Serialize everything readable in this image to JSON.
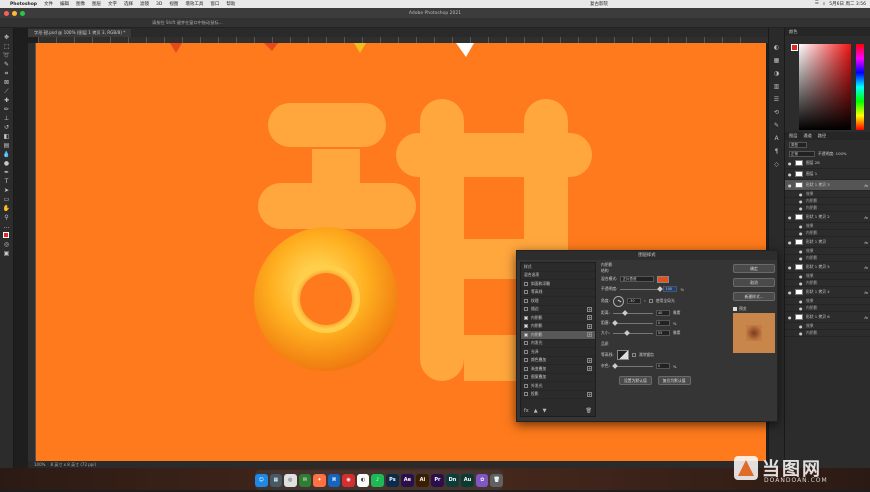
{
  "menubar": {
    "app": "Photoshop",
    "items": [
      "文件",
      "编辑",
      "图像",
      "图层",
      "文字",
      "选择",
      "滤镜",
      "3D",
      "视图",
      "增效工具",
      "窗口",
      "帮助"
    ],
    "center_text": "复古影院",
    "right_items": [
      "☰",
      "⌕",
      "5月6日 周二 3:56"
    ]
  },
  "titlebar": {
    "title": "Adobe Photoshop 2021"
  },
  "options_bar": {
    "hint": "请按住 Shift 键并在窗口中拖动鼠标…"
  },
  "document_tab": {
    "label": "字形·甜.psd @ 100% (图层 1 拷贝 3, RGB/8) *"
  },
  "status_bar": {
    "zoom": "100%",
    "info": "8 英寸 x 8 英寸 (72 ppi)"
  },
  "canvas": {
    "background": "#fe7a1c",
    "glyph_color": "#ffa63d",
    "donut_colors": [
      "#fdd835",
      "#ff9800",
      "#e65100"
    ]
  },
  "layers_panel": {
    "tabs": [
      "图层",
      "通道",
      "路径"
    ],
    "search_label": "类型",
    "blend_mode": "正常",
    "opacity_label": "不透明度: 100%",
    "layers": [
      {
        "name": "图层 28",
        "selected": false
      },
      {
        "name": "图层 1",
        "selected": false
      },
      {
        "name": "形状 1 拷贝 3",
        "selected": true,
        "fx": true
      },
      {
        "name": "效果",
        "sub": true
      },
      {
        "name": "内阴影",
        "sub": true
      },
      {
        "name": "内阴影",
        "sub": true
      },
      {
        "name": "形状 1 拷贝 2",
        "selected": false,
        "fx": true
      },
      {
        "name": "效果",
        "sub": true
      },
      {
        "name": "内阴影",
        "sub": true
      },
      {
        "name": "形状 1 拷贝",
        "selected": false,
        "fx": true
      },
      {
        "name": "效果",
        "sub": true
      },
      {
        "name": "内阴影",
        "sub": true
      },
      {
        "name": "形状 1 拷贝 5",
        "selected": false,
        "fx": true
      },
      {
        "name": "效果",
        "sub": true
      },
      {
        "name": "内阴影",
        "sub": true
      },
      {
        "name": "形状 1 拷贝 4",
        "selected": false,
        "fx": true
      },
      {
        "name": "效果",
        "sub": true
      },
      {
        "name": "内阴影",
        "sub": true
      },
      {
        "name": "形状 1 拷贝 6",
        "selected": false,
        "fx": true
      },
      {
        "name": "效果",
        "sub": true
      },
      {
        "name": "内阴影",
        "sub": true
      }
    ]
  },
  "dialog": {
    "title": "图层样式",
    "styles_header": "样式",
    "blend_options": "混合选项",
    "styles": [
      {
        "label": "斜面和浮雕",
        "checked": false,
        "plus": false
      },
      {
        "label": "等高线",
        "checked": false,
        "plus": false
      },
      {
        "label": "纹理",
        "checked": false,
        "plus": false
      },
      {
        "label": "描边",
        "checked": false,
        "plus": true
      },
      {
        "label": "内阴影",
        "checked": true,
        "plus": true
      },
      {
        "label": "内阴影",
        "checked": true,
        "plus": true
      },
      {
        "label": "内阴影",
        "checked": true,
        "plus": true,
        "selected": true
      },
      {
        "label": "内发光",
        "checked": false,
        "plus": false
      },
      {
        "label": "光泽",
        "checked": false,
        "plus": false
      },
      {
        "label": "颜色叠加",
        "checked": false,
        "plus": true
      },
      {
        "label": "渐变叠加",
        "checked": false,
        "plus": true
      },
      {
        "label": "图案叠加",
        "checked": false,
        "plus": false
      },
      {
        "label": "外发光",
        "checked": false,
        "plus": false
      },
      {
        "label": "投影",
        "checked": false,
        "plus": true
      }
    ],
    "section_title": "内阴影",
    "section_sub": "结构",
    "blend_mode_label": "混合模式:",
    "blend_mode_value": "正片叠底",
    "shadow_color": "#e3501b",
    "opacity_label": "不透明度:",
    "opacity_value": "100",
    "angle_label": "角度:",
    "angle_value": "-30",
    "global_light": "使用全局光",
    "distance_label": "距离:",
    "distance_value": "40",
    "choke_label": "阻塞:",
    "choke_value": "0",
    "size_label": "大小:",
    "size_value": "55",
    "unit_px": "像素",
    "unit_pct": "%",
    "quality_title": "品质",
    "contour_label": "等高线:",
    "antialias": "消除锯齿",
    "noise_label": "杂色:",
    "noise_value": "0",
    "default_btn": "设置为默认值",
    "reset_btn": "复位为默认值",
    "ok": "确定",
    "cancel": "取消",
    "new_style": "新建样式...",
    "preview_label": "预览"
  },
  "dock": {
    "apps": [
      {
        "name": "Ps",
        "color": "#0c2a4a"
      },
      {
        "name": "Ae",
        "color": "#2a0f4a"
      },
      {
        "name": "Ai",
        "color": "#3a1e02"
      },
      {
        "name": "Pr",
        "color": "#2a0f4a"
      },
      {
        "name": "Dn",
        "color": "#0b3d3a"
      },
      {
        "name": "Au",
        "color": "#0b3a30"
      }
    ]
  },
  "watermark": {
    "text": "当图网",
    "sub": "DOANDOAN.COM"
  }
}
